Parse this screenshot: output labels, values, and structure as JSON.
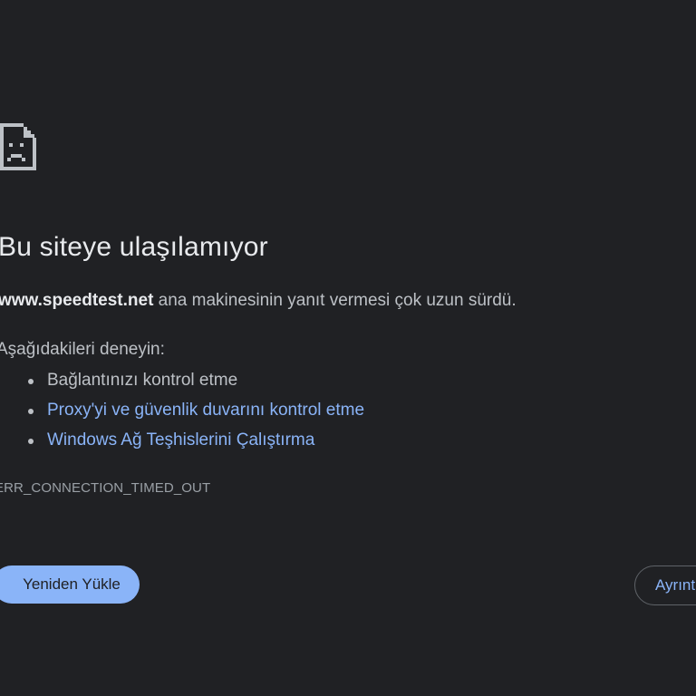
{
  "error_page": {
    "icon": "sad-page-icon",
    "title": "Bu siteye ulaşılamıyor",
    "summary_host": "www.speedtest.net",
    "summary_text": " ana makinesinin yanıt vermesi çok uzun sürdü.",
    "try_label": "Aşağıdakileri deneyin:",
    "suggestions": [
      {
        "label": "Bağlantınızı kontrol etme",
        "type": "text"
      },
      {
        "label": "Proxy'yi ve güvenlik duvarını kontrol etme",
        "type": "link"
      },
      {
        "label": "Windows Ağ Teşhislerini Çalıştırma",
        "type": "link"
      }
    ],
    "error_code": "ERR_CONNECTION_TIMED_OUT",
    "reload_label": "Yeniden Yükle",
    "details_label": "Ayrıntılar"
  },
  "colors": {
    "background": "#202124",
    "link": "#8ab4f8",
    "text": "#bdc1c6",
    "title": "#e8eaed",
    "primary_button": "#8ab4f8"
  }
}
